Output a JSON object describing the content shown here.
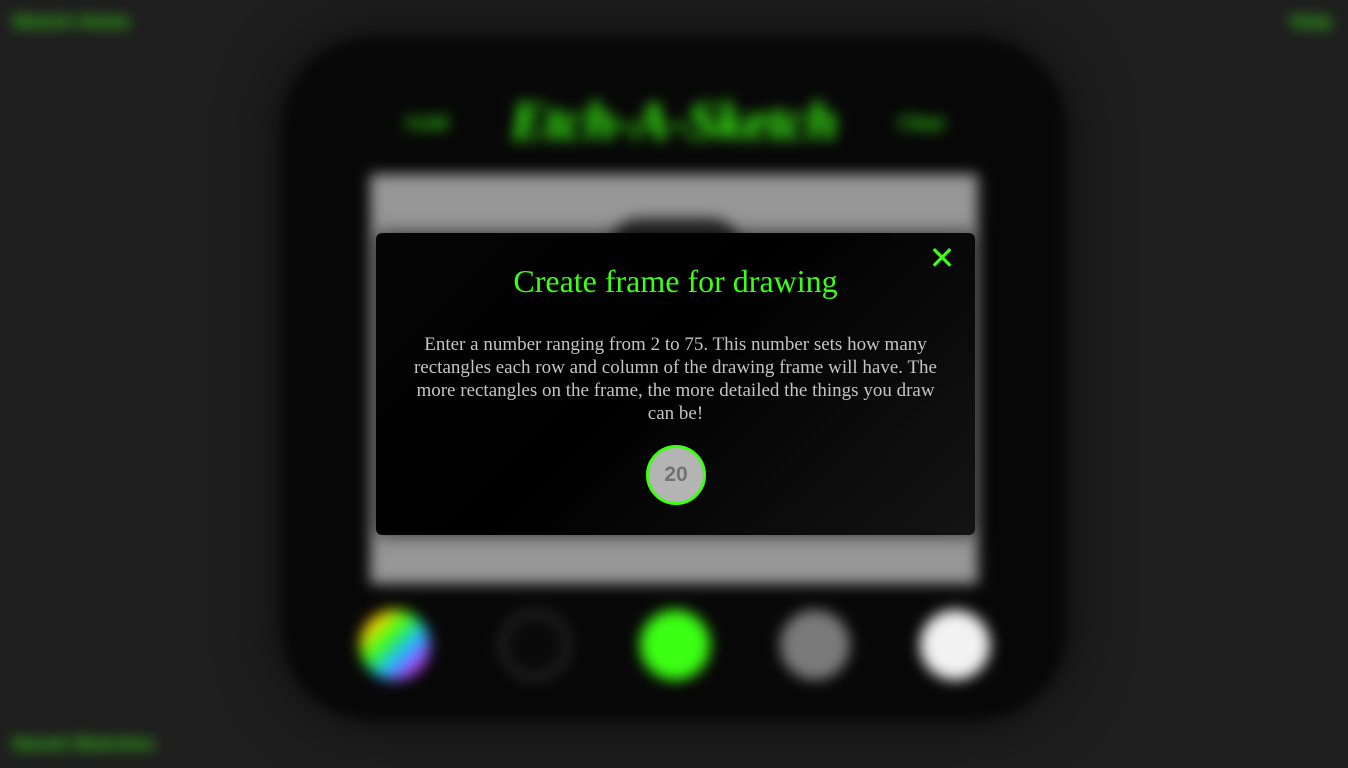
{
  "page": {
    "top_left_link": "Sketch Home",
    "top_right_link": "Help",
    "bottom_left_link": "Saved Sketches"
  },
  "device": {
    "left_label": "Grid",
    "title": "Etch-A-Sketch",
    "right_label": "Clear"
  },
  "palette": [
    "rainbow",
    "black",
    "green",
    "gray",
    "white"
  ],
  "modal": {
    "title": "Create frame for drawing",
    "description": "Enter a number ranging from 2 to 75. This number sets how many rectangles each row and column of the drawing frame will have. The more rectangles on the frame, the more detailed the things you draw can be!",
    "input_value": "20",
    "close_icon": "close-icon",
    "accent_color": "#3cff14"
  }
}
